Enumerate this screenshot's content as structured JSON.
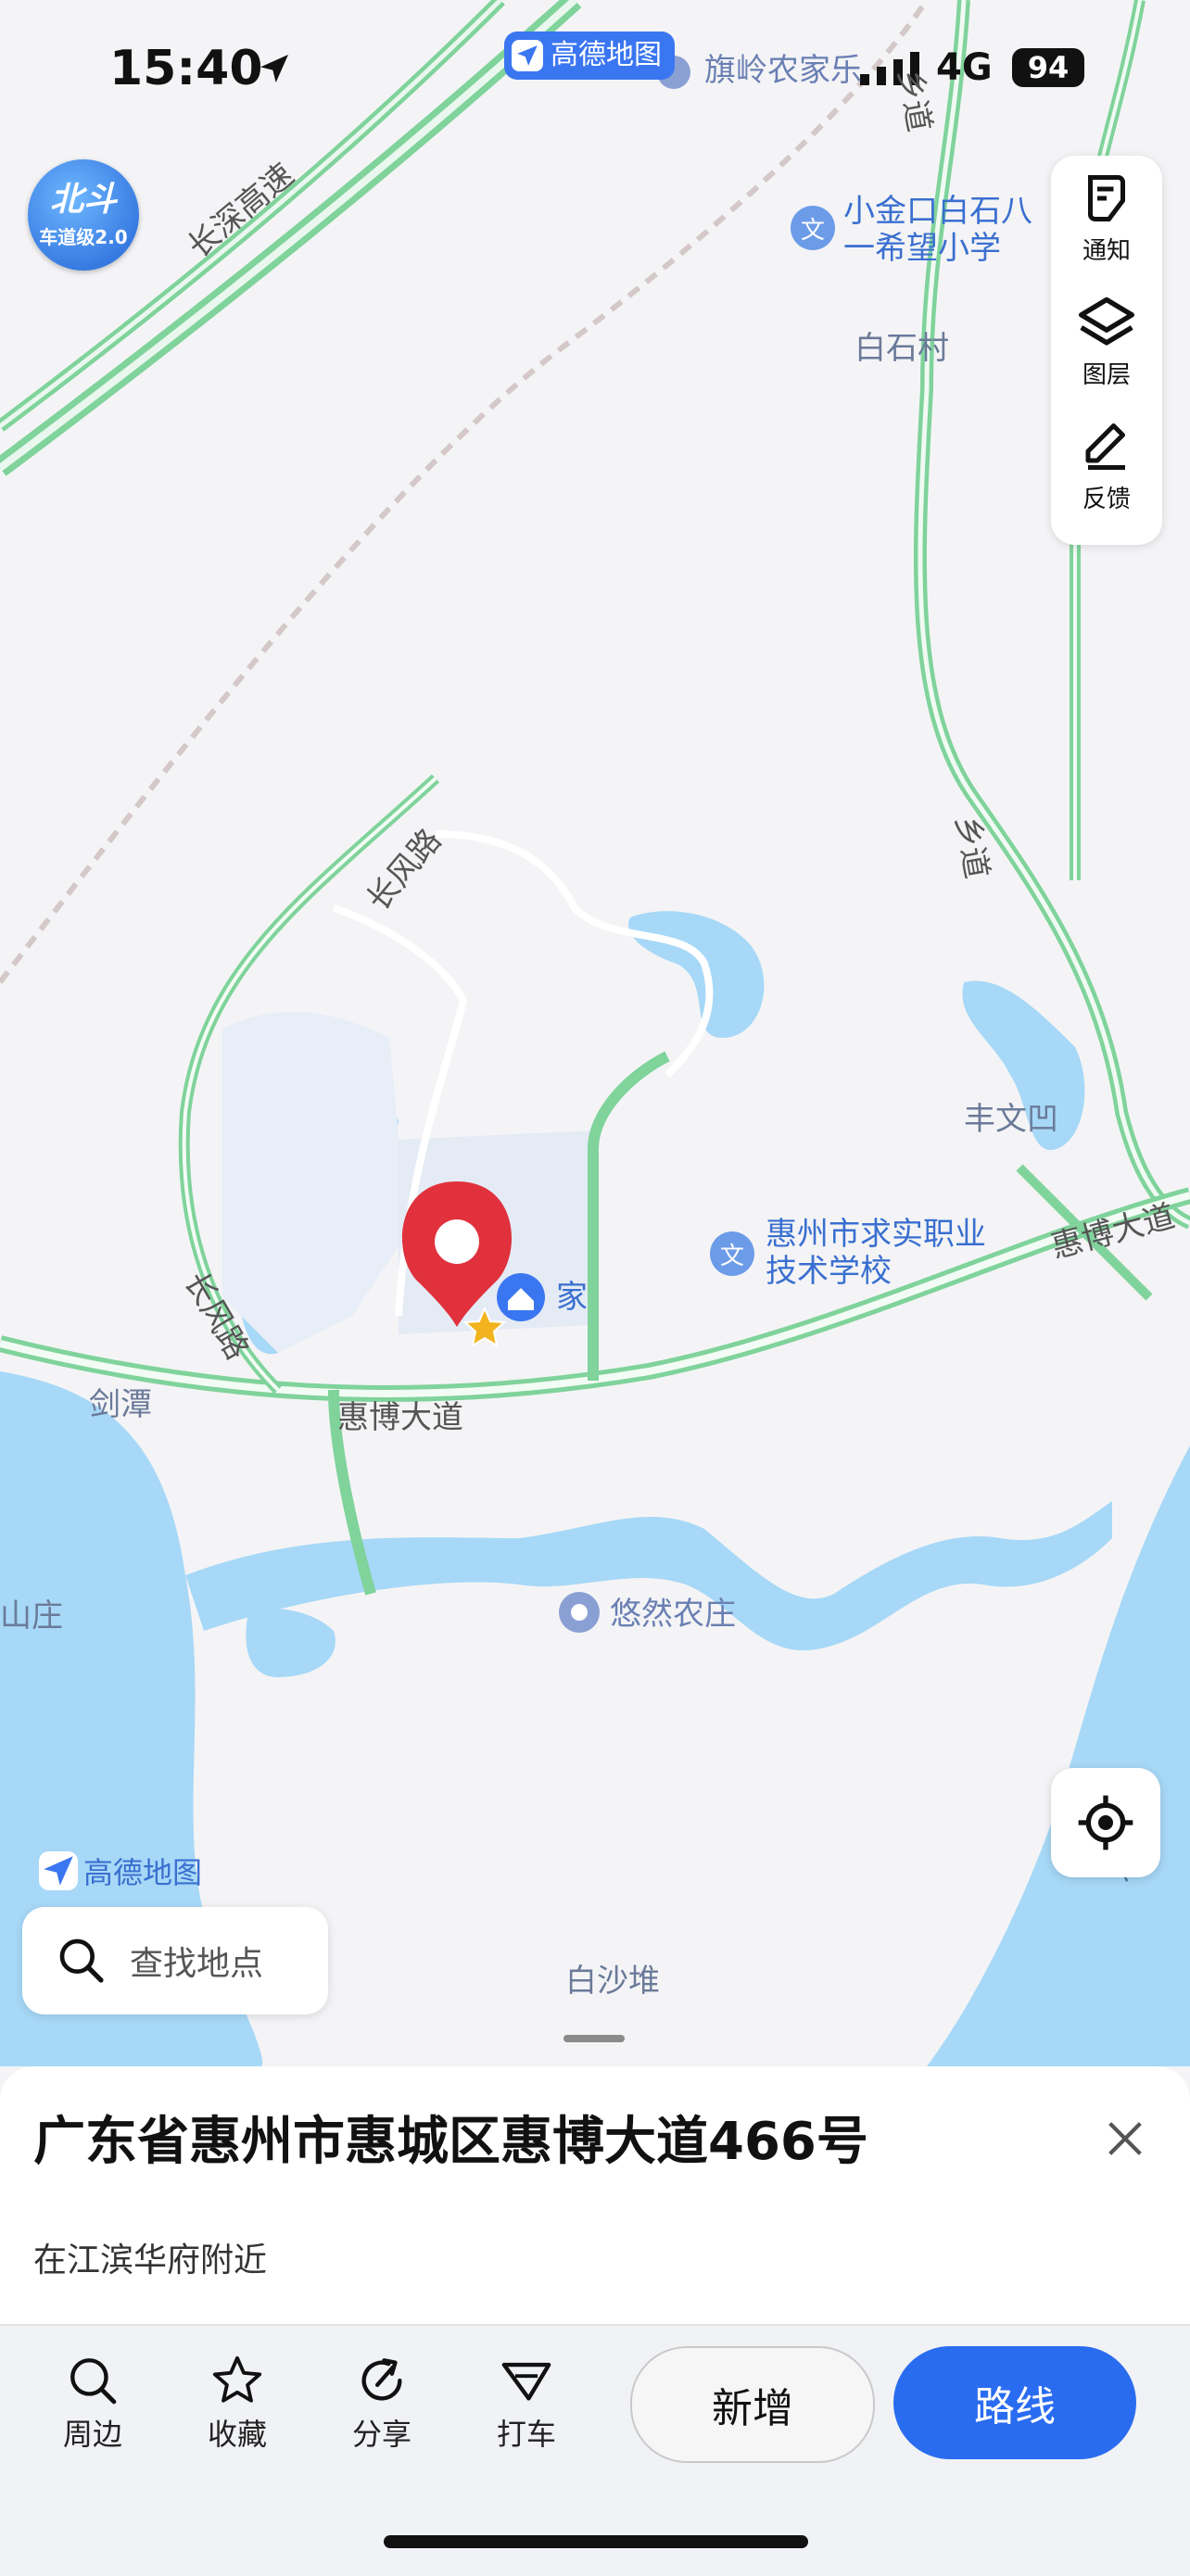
{
  "status": {
    "time": "15:40",
    "network": "4G",
    "battery": "94"
  },
  "brand": {
    "name": "高德地图"
  },
  "badge": {
    "line1": "北斗",
    "line2": "车道级2.0"
  },
  "side_panel": {
    "items": [
      {
        "label": "通知"
      },
      {
        "label": "图层"
      },
      {
        "label": "反馈"
      }
    ]
  },
  "map": {
    "pois": [
      {
        "name": "旗岭农家乐"
      },
      {
        "name": "小金口白石八一希望小学"
      },
      {
        "name": "惠州市求实职业技术学校"
      },
      {
        "name": "悠然农庄"
      },
      {
        "name": "家"
      }
    ],
    "places": {
      "baishi": "白石村",
      "fengwen": "丰文凹",
      "jiantan": "剑潭",
      "baishadui": "白沙堆",
      "shanzhuang": "山庄"
    },
    "roads": {
      "changshen": "长深高速",
      "changfeng_top": "长风路",
      "changfeng_left": "长风路",
      "xiangdao_top": "乡道",
      "xiangdao_mid": "乡道",
      "huibo_main": "惠博大道",
      "huibo_right": "惠博大道",
      "dong": "东"
    }
  },
  "search": {
    "placeholder": "查找地点"
  },
  "sheet": {
    "title": "广东省惠州市惠城区惠博大道466号",
    "subtitle": "在江滨华府附近"
  },
  "actions": [
    {
      "label": "周边"
    },
    {
      "label": "收藏"
    },
    {
      "label": "分享"
    },
    {
      "label": "打车"
    }
  ],
  "buttons": {
    "new": "新增",
    "route": "路线"
  },
  "colors": {
    "water": "#a7d8f7",
    "road_green": "#6bd08f",
    "accent": "#2a6cf0",
    "pin": "#e0313d"
  }
}
